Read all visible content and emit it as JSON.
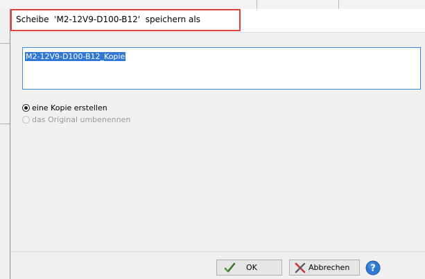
{
  "dialog": {
    "title": "Scheibe  'M2-12V9-D100-B12'  speichern als",
    "name_value": "M2-12V9-D100-B12_Kopie",
    "options": [
      {
        "label": "eine Kopie erstellen",
        "checked": true,
        "enabled": true
      },
      {
        "label": "das Original umbenennen",
        "checked": false,
        "enabled": false
      }
    ],
    "buttons": {
      "ok_label": "OK",
      "cancel_label": "Abbrechen"
    }
  },
  "icons": {
    "ok": "check-icon",
    "cancel": "x-icon",
    "help": "help-icon"
  },
  "colors": {
    "highlight_border": "#e0403c",
    "selection": "#3178d6",
    "input_border": "#3a8ad6",
    "check_green": "#3a7d2a",
    "cancel_red": "#c8322a",
    "help_blue": "#2f7bd3"
  }
}
